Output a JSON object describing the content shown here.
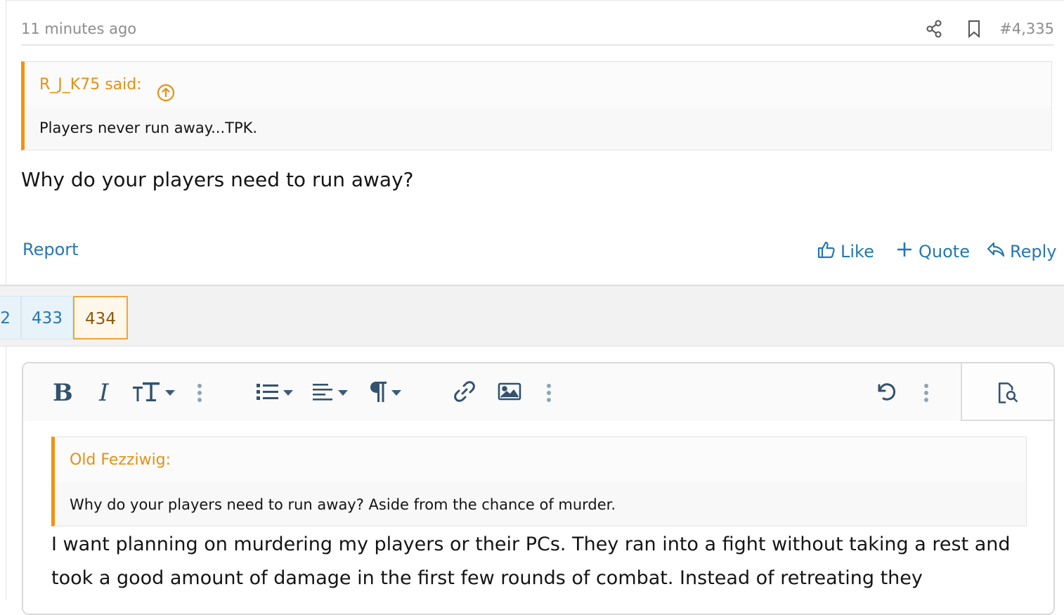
{
  "post": {
    "timestamp": "11 minutes ago",
    "post_number": "#4,335",
    "quote": {
      "author_said": "R_J_K75 said:",
      "text": "Players never run away...TPK."
    },
    "body": "Why do your players need to run away?",
    "actions": {
      "report": "Report",
      "like": "Like",
      "quote": "Quote",
      "reply": "Reply"
    }
  },
  "pagination": {
    "pages": [
      "2",
      "433",
      "434"
    ],
    "current": "434"
  },
  "editor": {
    "toolbar": {
      "bold": "B",
      "italic": "I"
    },
    "quote": {
      "author": "Old Fezziwig:",
      "text": "Why do your players need to run away? Aside from the chance of murder."
    },
    "text": "I want planning on murdering my players or their PCs. They ran into a fight without taking a rest and took a good amount of damage in the first few rounds of combat. Instead of retreating they"
  },
  "colors": {
    "accent_link": "#2577b1",
    "quote_border": "#f2930d",
    "quote_title": "#e59013"
  }
}
